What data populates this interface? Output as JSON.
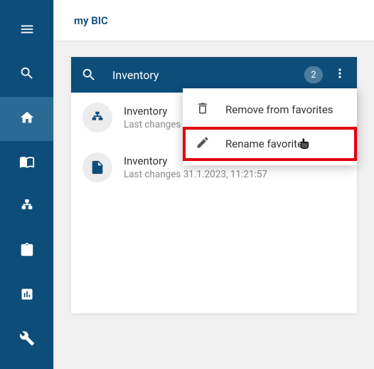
{
  "app": {
    "title": "my BIC"
  },
  "sidebar": {
    "items": [
      {
        "name": "menu"
      },
      {
        "name": "search"
      },
      {
        "name": "home"
      },
      {
        "name": "catalog"
      },
      {
        "name": "hierarchy"
      },
      {
        "name": "tasks"
      },
      {
        "name": "dashboard"
      },
      {
        "name": "admin"
      }
    ]
  },
  "card": {
    "title": "Inventory",
    "count": "2"
  },
  "items": [
    {
      "title": "Inventory",
      "subtitle": "Last changes"
    },
    {
      "title": "Inventory",
      "subtitle": "Last changes 31.1.2023, 11:21:57"
    }
  ],
  "menu": {
    "remove": "Remove from favorites",
    "rename": "Rename favorite"
  }
}
